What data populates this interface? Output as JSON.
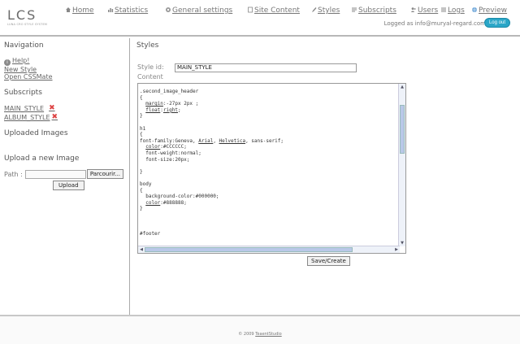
{
  "header": {
    "logo": "LCS",
    "logo_sub": "LUNA CRO STYLE SYSTEM",
    "nav": [
      {
        "label": "Home",
        "icon": "home-icon"
      },
      {
        "label": "Statistics",
        "icon": "chart-icon"
      },
      {
        "label": "General settings",
        "icon": "gear-icon"
      },
      {
        "label": "Site Content",
        "icon": "page-icon"
      },
      {
        "label": "Styles",
        "icon": "brush-icon"
      },
      {
        "label": "Subscripts",
        "icon": "script-icon"
      },
      {
        "label": "Users",
        "icon": "users-icon"
      },
      {
        "label": "Logs",
        "icon": "list-icon"
      },
      {
        "label": "Preview",
        "icon": "globe-icon"
      }
    ],
    "logged_in": "Logged as info@muryal-regard.com",
    "logout": "Log out"
  },
  "sidebar": {
    "nav_title": "Navigation",
    "help": "Help!",
    "new_style": "New Style",
    "open_cssmate": "Open CSSMate",
    "subscripts_title": "Subscripts",
    "subscripts": [
      "MAIN_STYLE",
      "ALBUM_STYLE"
    ],
    "uploaded_title": "Uploaded Images",
    "upload_title": "Upload a new Image",
    "path_label": "Path :",
    "browse": "Parcourir...",
    "upload": "Upload"
  },
  "main": {
    "title": "Styles",
    "style_id_label": "Style id:",
    "style_id_value": "MAIN_STYLE",
    "content_label": "Content",
    "save": "Save/Create"
  },
  "footer": {
    "prefix": "© 2009",
    "link": "TeaentStudio"
  },
  "colors": {
    "logout_bg": "#2aa6c7",
    "delete_icon": "#d44444",
    "scroll_thumb": "#b9c8e8"
  }
}
